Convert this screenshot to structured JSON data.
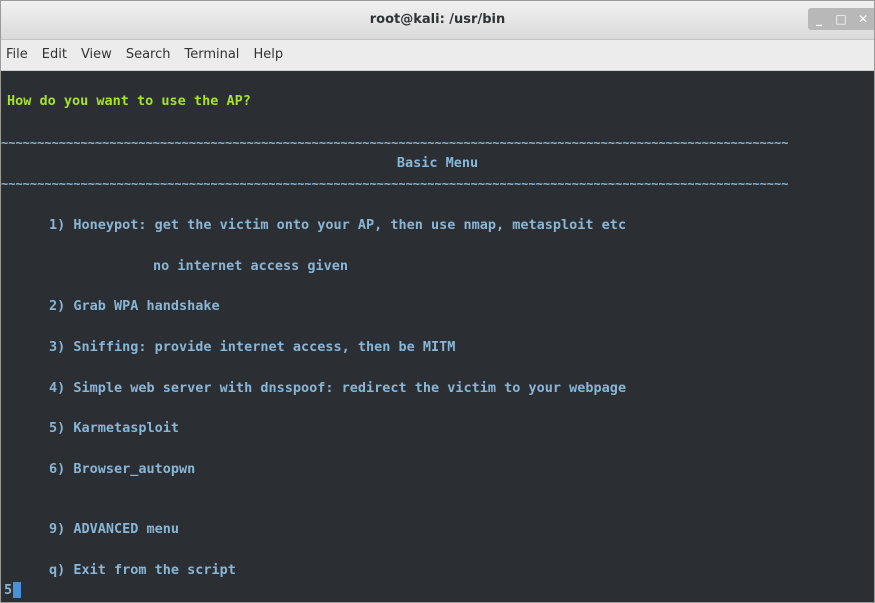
{
  "window": {
    "title": "root@kali: /usr/bin",
    "controls": {
      "minimize": "_",
      "maximize": "□",
      "close": "✕"
    }
  },
  "menubar": {
    "items": [
      "File",
      "Edit",
      "View",
      "Search",
      "Terminal",
      "Help"
    ]
  },
  "terminal": {
    "question": "How do you want to use the AP?",
    "separator": "~~~~~~~~~~~~~~~~~~~~~~~~~~~~~~~~~~~~~~~~~~~~~~~~~~~~~~~~~~~~~~~~~~~~~~~~~~~~~~~~~~~~~~~~~~~~~~~~~~~~~~~~~~~~~",
    "menu_title": "Basic Menu",
    "options": [
      "1) Honeypot: get the victim onto your AP, then use nmap, metasploit etc",
      "no internet access given",
      "2) Grab WPA handshake",
      "3) Sniffing: provide internet access, then be MITM",
      "4) Simple web server with dnsspoof: redirect the victim to your webpage",
      "5) Karmetasploit",
      "6) Browser_autopwn",
      "9) ADVANCED menu",
      "q) Exit from the script"
    ],
    "input_value": "5",
    "colors": {
      "background": "#2b2e33",
      "prompt": "#a6e22e",
      "text": "#8ab6d6",
      "cursor": "#4a90d9"
    }
  }
}
